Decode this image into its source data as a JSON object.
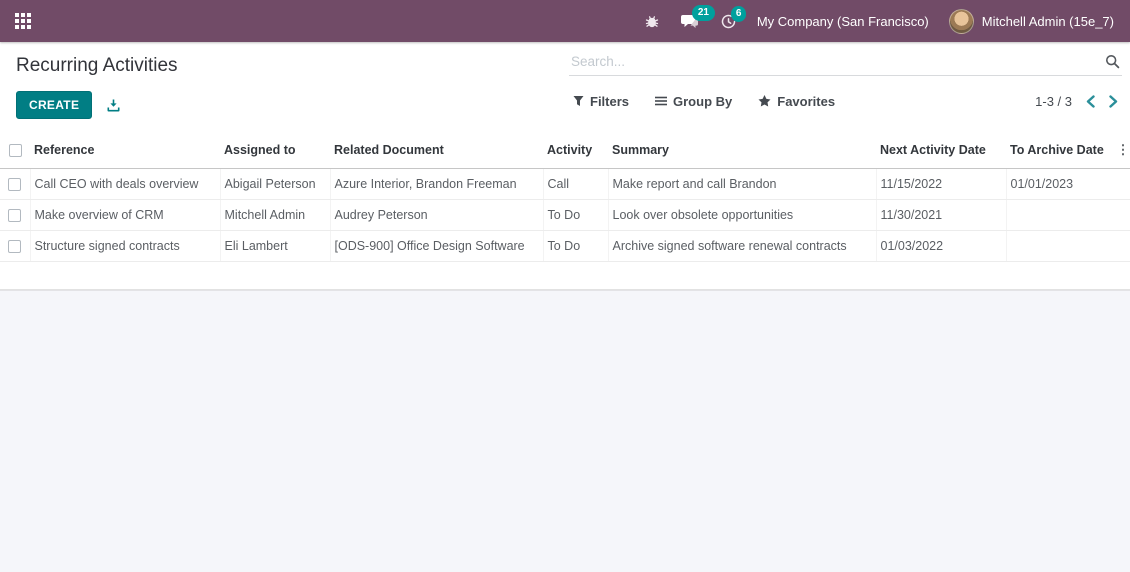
{
  "navbar": {
    "company": "My Company (San Francisco)",
    "user": "Mitchell Admin (15e_7)",
    "messages_count": "21",
    "activities_count": "6"
  },
  "colors": {
    "topbar": "#714B67",
    "accent_teal": "#017e84",
    "badge_teal": "#00a09d"
  },
  "icons": {
    "apps": "grid-icon",
    "debug": "bug-icon",
    "messages": "chat-icon",
    "activities": "clock-icon",
    "search": "magnifier-icon",
    "export": "download-icon",
    "filters": "funnel-icon",
    "group_by": "lines-icon",
    "favorites": "star-icon",
    "column_options": "vertical-dots-icon"
  },
  "header": {
    "title": "Recurring Activities",
    "create_label": "CREATE"
  },
  "search": {
    "placeholder": "Search...",
    "value": ""
  },
  "controls": {
    "filters": "Filters",
    "group_by": "Group By",
    "favorites": "Favorites",
    "pager": "1-3 / 3"
  },
  "table": {
    "columns": [
      "Reference",
      "Assigned to",
      "Related Document",
      "Activity",
      "Summary",
      "Next Activity Date",
      "To Archive Date"
    ],
    "column_keys": [
      "reference",
      "assigned_to",
      "related_document",
      "activity",
      "summary",
      "next_activity_date",
      "to_archive_date"
    ],
    "options_glyph": "⋮",
    "rows": [
      {
        "reference": "Call CEO with deals overview",
        "assigned_to": "Abigail Peterson",
        "related_document": "Azure Interior, Brandon Freeman",
        "activity": "Call",
        "summary": "Make report and call Brandon",
        "next_activity_date": "11/15/2022",
        "to_archive_date": "01/01/2023"
      },
      {
        "reference": "Make overview of CRM",
        "assigned_to": "Mitchell Admin",
        "related_document": "Audrey Peterson",
        "activity": "To Do",
        "summary": "Look over obsolete opportunities",
        "next_activity_date": "11/30/2021",
        "to_archive_date": ""
      },
      {
        "reference": "Structure signed contracts",
        "assigned_to": "Eli Lambert",
        "related_document": "[ODS-900] Office Design Software",
        "activity": "To Do",
        "summary": "Archive signed software renewal contracts",
        "next_activity_date": "01/03/2022",
        "to_archive_date": ""
      }
    ]
  }
}
